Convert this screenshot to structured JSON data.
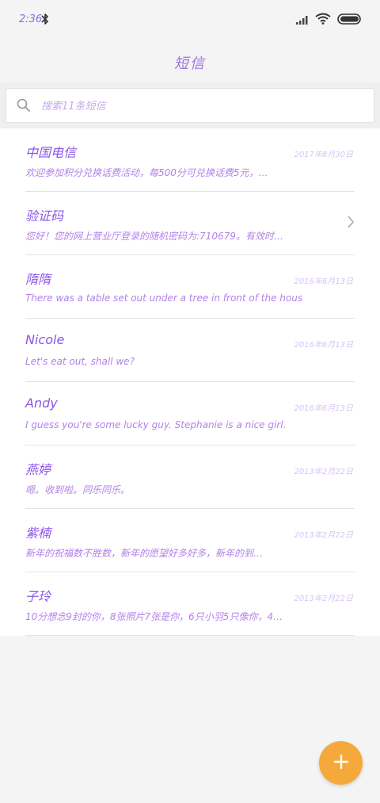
{
  "status_bar": {
    "time": "2:36",
    "icons": [
      "bluetooth-icon",
      "signal-icon",
      "wifi-icon",
      "battery-icon"
    ]
  },
  "header": {
    "title": "短信"
  },
  "search": {
    "placeholder": "搜索11条短信"
  },
  "messages": [
    {
      "sender": "中国电信",
      "date": "2017年8月30日",
      "preview": "欢迎参加积分兑换话费活动，每500分可兑换话费5元，…"
    },
    {
      "sender": "验证码",
      "date": "",
      "preview": "您好！您的网上营业厅登录的随机密码为:710679。有效时…",
      "icon": "chevron-right-icon"
    },
    {
      "sender": "隋隋",
      "date": "2016年6月13日",
      "preview": "There was a table set out under a tree in front of the hous"
    },
    {
      "sender": "Nicole",
      "date": "2016年6月13日",
      "preview": "Let's eat out, shall we?"
    },
    {
      "sender": "Andy",
      "date": "2016年6月13日",
      "preview": "I guess you're some lucky guy. Stephanie is a nice girl."
    },
    {
      "sender": "燕婷",
      "date": "2013年2月22日",
      "preview": "嗯。收到啦。同乐同乐。"
    },
    {
      "sender": "紫楠",
      "date": "2013年2月22日",
      "preview": "新年的祝福数不胜数，新年的愿望好多好多，新年的到…"
    },
    {
      "sender": "子玲",
      "date": "2013年2月22日",
      "preview": "10分想念9封的你，8张照片7张是你，6只小羽5只像你，4…"
    }
  ],
  "fab": {
    "icon": "plus-icon"
  },
  "colors": {
    "accent": "#8a55e8",
    "date": "#d7c2f5",
    "fab": "#f6a93b",
    "background": "#f4f4f4"
  }
}
